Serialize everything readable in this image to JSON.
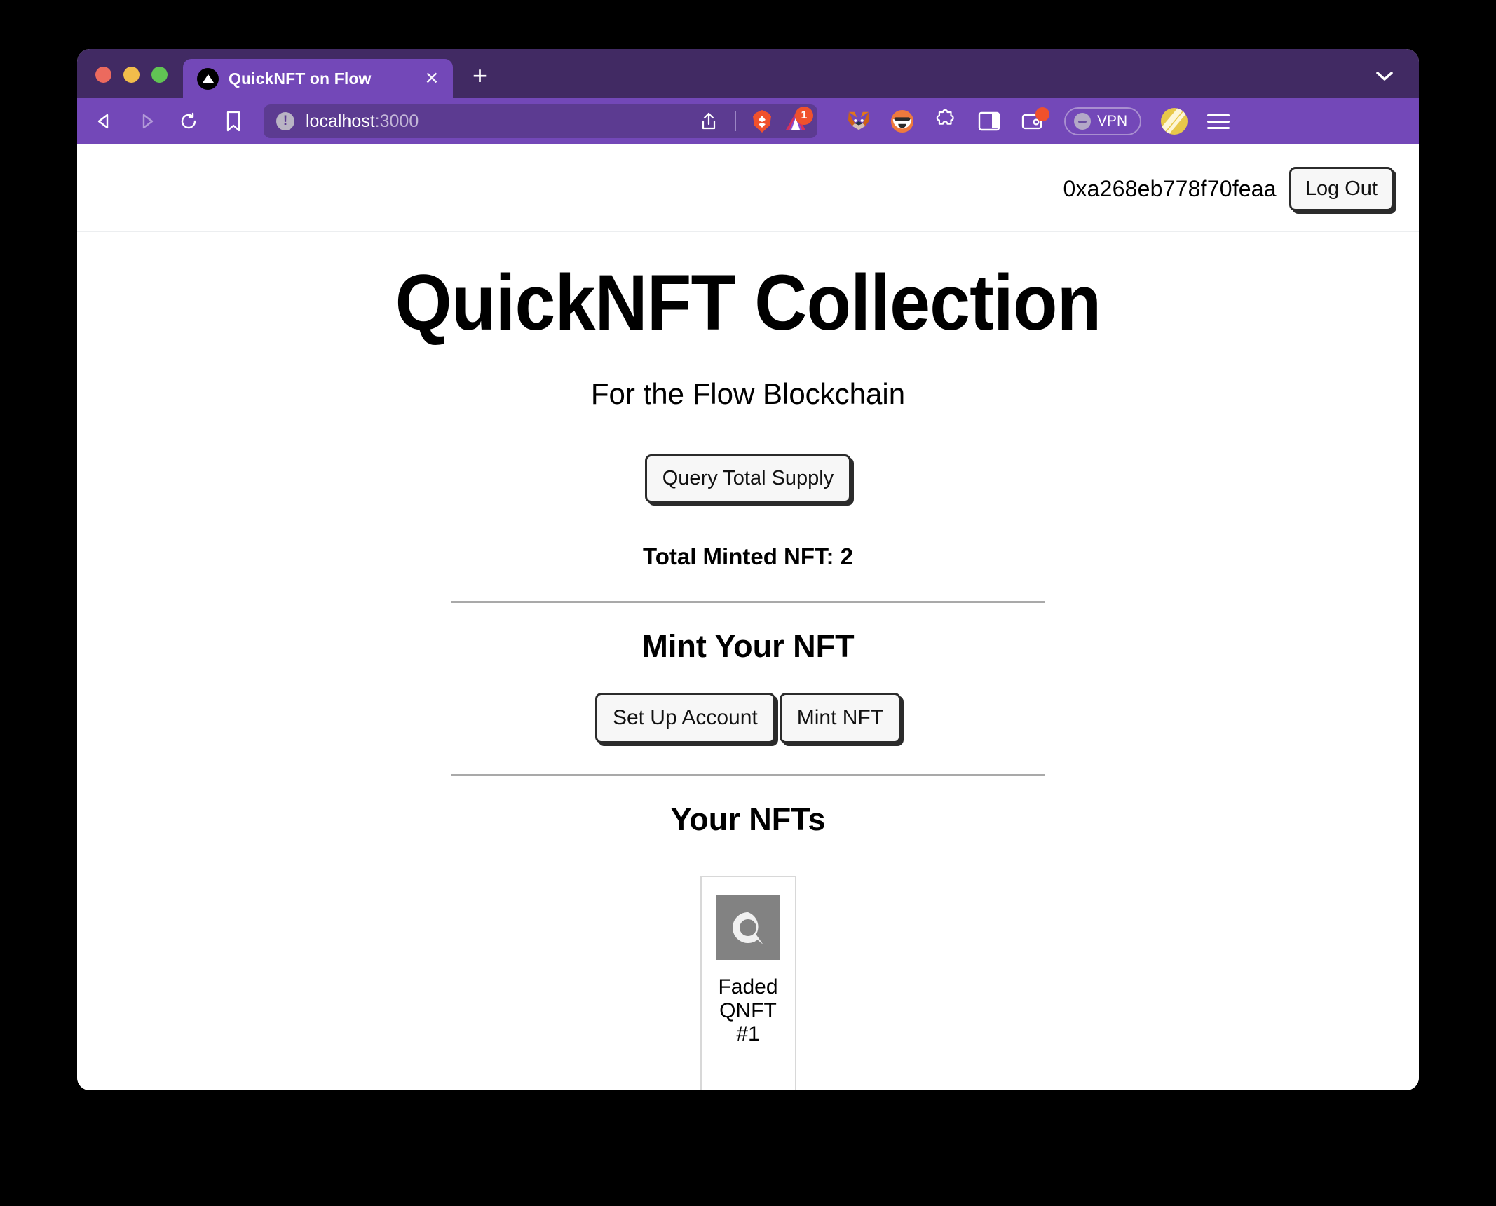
{
  "browser": {
    "traffic_lights": [
      "close",
      "minimize",
      "maximize"
    ],
    "tab": {
      "title": "QuickNFT on Flow",
      "favicon": "triangle-favicon",
      "close_label": "✕"
    },
    "new_tab_label": "+",
    "tab_list_chevron": "chevron-down-icon",
    "nav": {
      "back": "back-arrow-icon",
      "forward": "forward-arrow-icon",
      "reload": "reload-icon",
      "bookmark": "bookmark-icon"
    },
    "url": {
      "info_glyph": "!",
      "host": "localhost",
      "port": ":3000",
      "share_icon": "share-icon"
    },
    "shields": {
      "brave_icon": "brave-lion-icon",
      "rewards_icon": "brave-rewards-triangle-icon",
      "rewards_badge": "1"
    },
    "extensions": [
      {
        "name": "metamask-fox-icon",
        "label": "MetaMask"
      },
      {
        "name": "blocto-cat-icon",
        "label": "Blocto"
      },
      {
        "name": "extensions-puzzle-icon",
        "label": "Extensions"
      },
      {
        "name": "sidebar-panel-icon",
        "label": "Sidebar"
      },
      {
        "name": "brave-wallet-icon",
        "label": "Wallet"
      }
    ],
    "vpn": {
      "label": "VPN",
      "icon": "vpn-shield-icon"
    },
    "profile_avatar": "profile-avatar",
    "menu": "hamburger-menu-icon"
  },
  "page": {
    "account": {
      "address": "0xa268eb778f70feaa",
      "logout_label": "Log Out"
    },
    "hero": {
      "title": "QuickNFT Collection",
      "subtitle": "For the Flow Blockchain"
    },
    "supply": {
      "query_button": "Query Total Supply",
      "total_minted_label": "Total Minted NFT: 2"
    },
    "mint": {
      "heading": "Mint Your NFT",
      "setup_button": "Set Up Account",
      "mint_button": "Mint NFT"
    },
    "collection": {
      "heading": "Your NFTs",
      "items": [
        {
          "name": "Faded QNFT #1",
          "thumb": "quicknft-q-logo"
        }
      ]
    }
  },
  "colors": {
    "tabstrip_bg": "#412a63",
    "toolbar_bg": "#7348b8",
    "active_tab_bg": "#7348b8",
    "urlbar_bg": "#5c3b91",
    "badge_red": "#f0512c",
    "button_border": "#2b2b2b",
    "nft_thumb_bg": "#828282"
  }
}
